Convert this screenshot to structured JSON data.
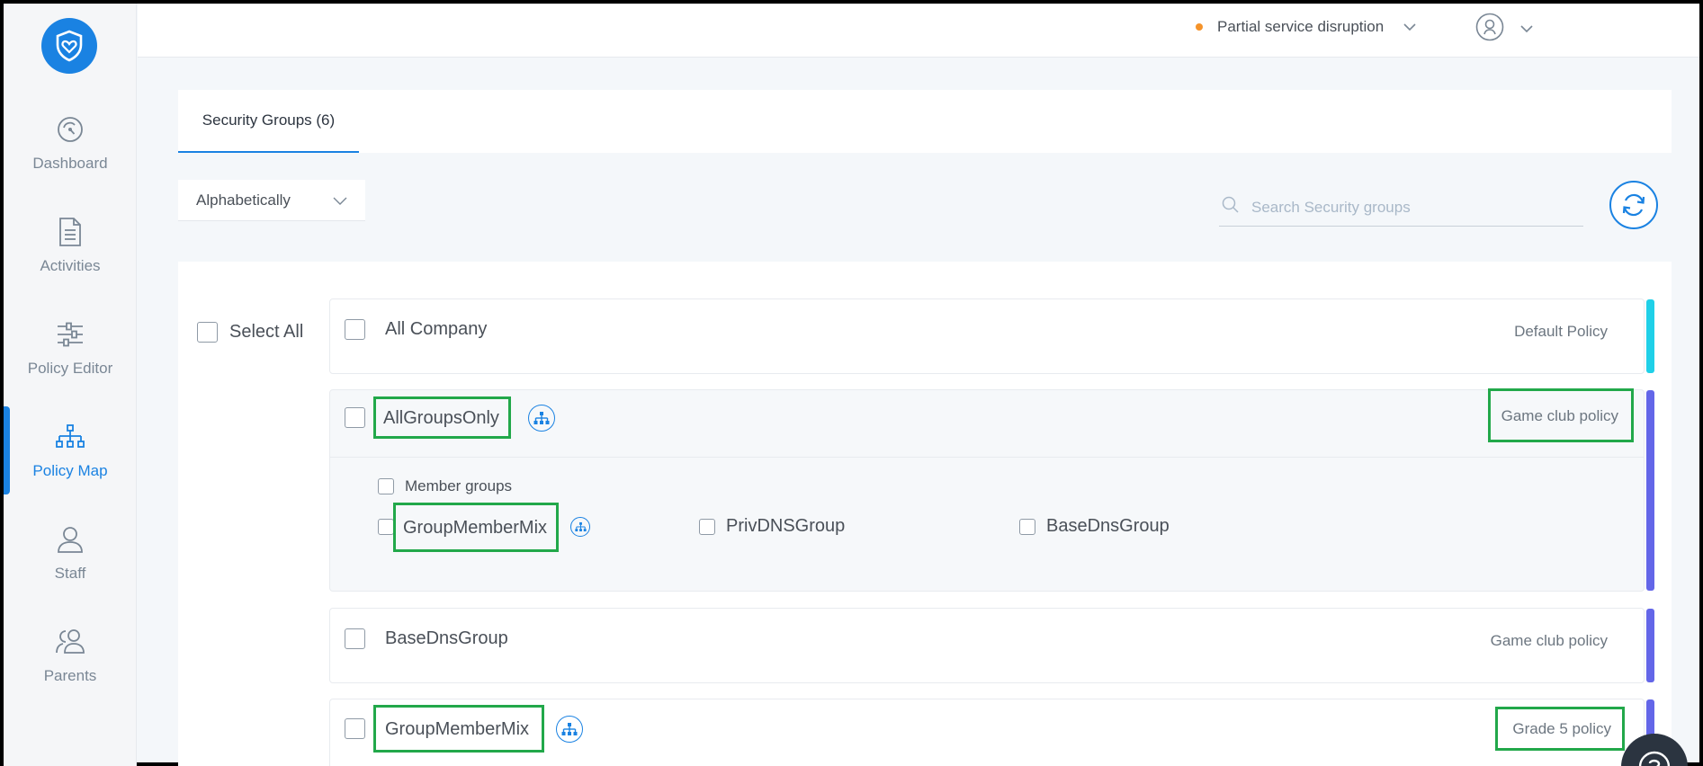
{
  "sidebar": {
    "items": [
      {
        "label": "Dashboard",
        "icon": "gauge-icon"
      },
      {
        "label": "Activities",
        "icon": "document-icon"
      },
      {
        "label": "Policy Editor",
        "icon": "sliders-icon"
      },
      {
        "label": "Policy Map",
        "icon": "hierarchy-icon",
        "active": true
      },
      {
        "label": "Staff",
        "icon": "user-icon"
      },
      {
        "label": "Parents",
        "icon": "users-icon"
      }
    ]
  },
  "topbar": {
    "status_text": "Partial service disruption",
    "status_color": "#f5932a"
  },
  "tabs": [
    {
      "label": "Security Groups (6)"
    }
  ],
  "toolbar": {
    "sort_value": "Alphabetically",
    "search_placeholder": "Search Security groups"
  },
  "list": {
    "select_all_label": "Select All",
    "groups": [
      {
        "name": "All Company",
        "policy": "Default Policy",
        "bar_color": "#1fd0e8"
      },
      {
        "name": "AllGroupsOnly",
        "policy": "Game club policy",
        "bar_color": "#6366e8",
        "member_groups_label": "Member groups",
        "members": [
          "GroupMemberMix",
          "PrivDNSGroup",
          "BaseDnsGroup"
        ]
      },
      {
        "name": "BaseDnsGroup",
        "policy": "Game club policy",
        "bar_color": "#6366e8"
      },
      {
        "name": "GroupMemberMix",
        "policy": "Grade 5 policy",
        "bar_color": "#6366e8"
      }
    ]
  },
  "colors": {
    "accent": "#1a82e2",
    "highlight": "#22a84a"
  }
}
